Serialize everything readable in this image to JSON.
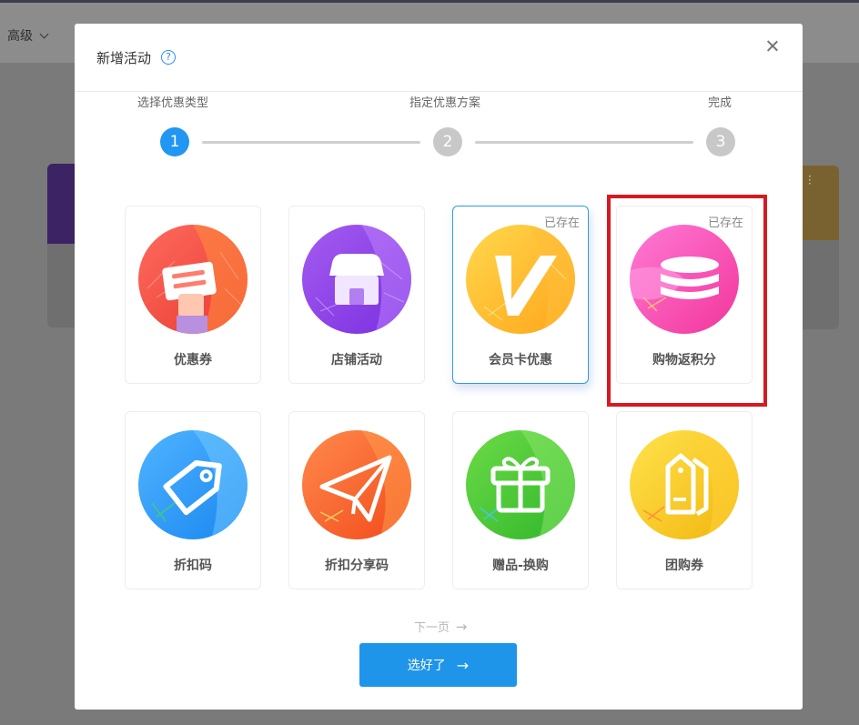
{
  "toolbar": {
    "advanced_label": "高级"
  },
  "modal": {
    "title": "新增活动",
    "help_glyph": "?"
  },
  "steps": [
    {
      "number": "1",
      "label": "选择优惠类型",
      "active": true
    },
    {
      "number": "2",
      "label": "指定优惠方案",
      "active": false
    },
    {
      "number": "3",
      "label": "完成",
      "active": false
    }
  ],
  "activity_types": [
    {
      "label": "优惠券",
      "icon": "coupon-icon",
      "exists": ""
    },
    {
      "label": "店铺活动",
      "icon": "store-icon",
      "exists": ""
    },
    {
      "label": "会员卡优惠",
      "icon": "vip-v-icon",
      "exists": "已存在",
      "selected": true
    },
    {
      "label": "购物返积分",
      "icon": "coin-stack-icon",
      "exists": "已存在"
    },
    {
      "label": "折扣码",
      "icon": "tag-icon",
      "exists": ""
    },
    {
      "label": "折扣分享码",
      "icon": "paper-plane-icon",
      "exists": ""
    },
    {
      "label": "赠品-换购",
      "icon": "gift-icon",
      "exists": ""
    },
    {
      "label": "团购券",
      "icon": "double-tag-icon",
      "exists": ""
    }
  ],
  "footer": {
    "next_page": "下一页",
    "confirm": "选好了"
  },
  "colors": {
    "primary": "#1f95ea",
    "step_active": "#2196f3",
    "step_inactive": "#c8c8c8",
    "highlight": "#d71920"
  }
}
